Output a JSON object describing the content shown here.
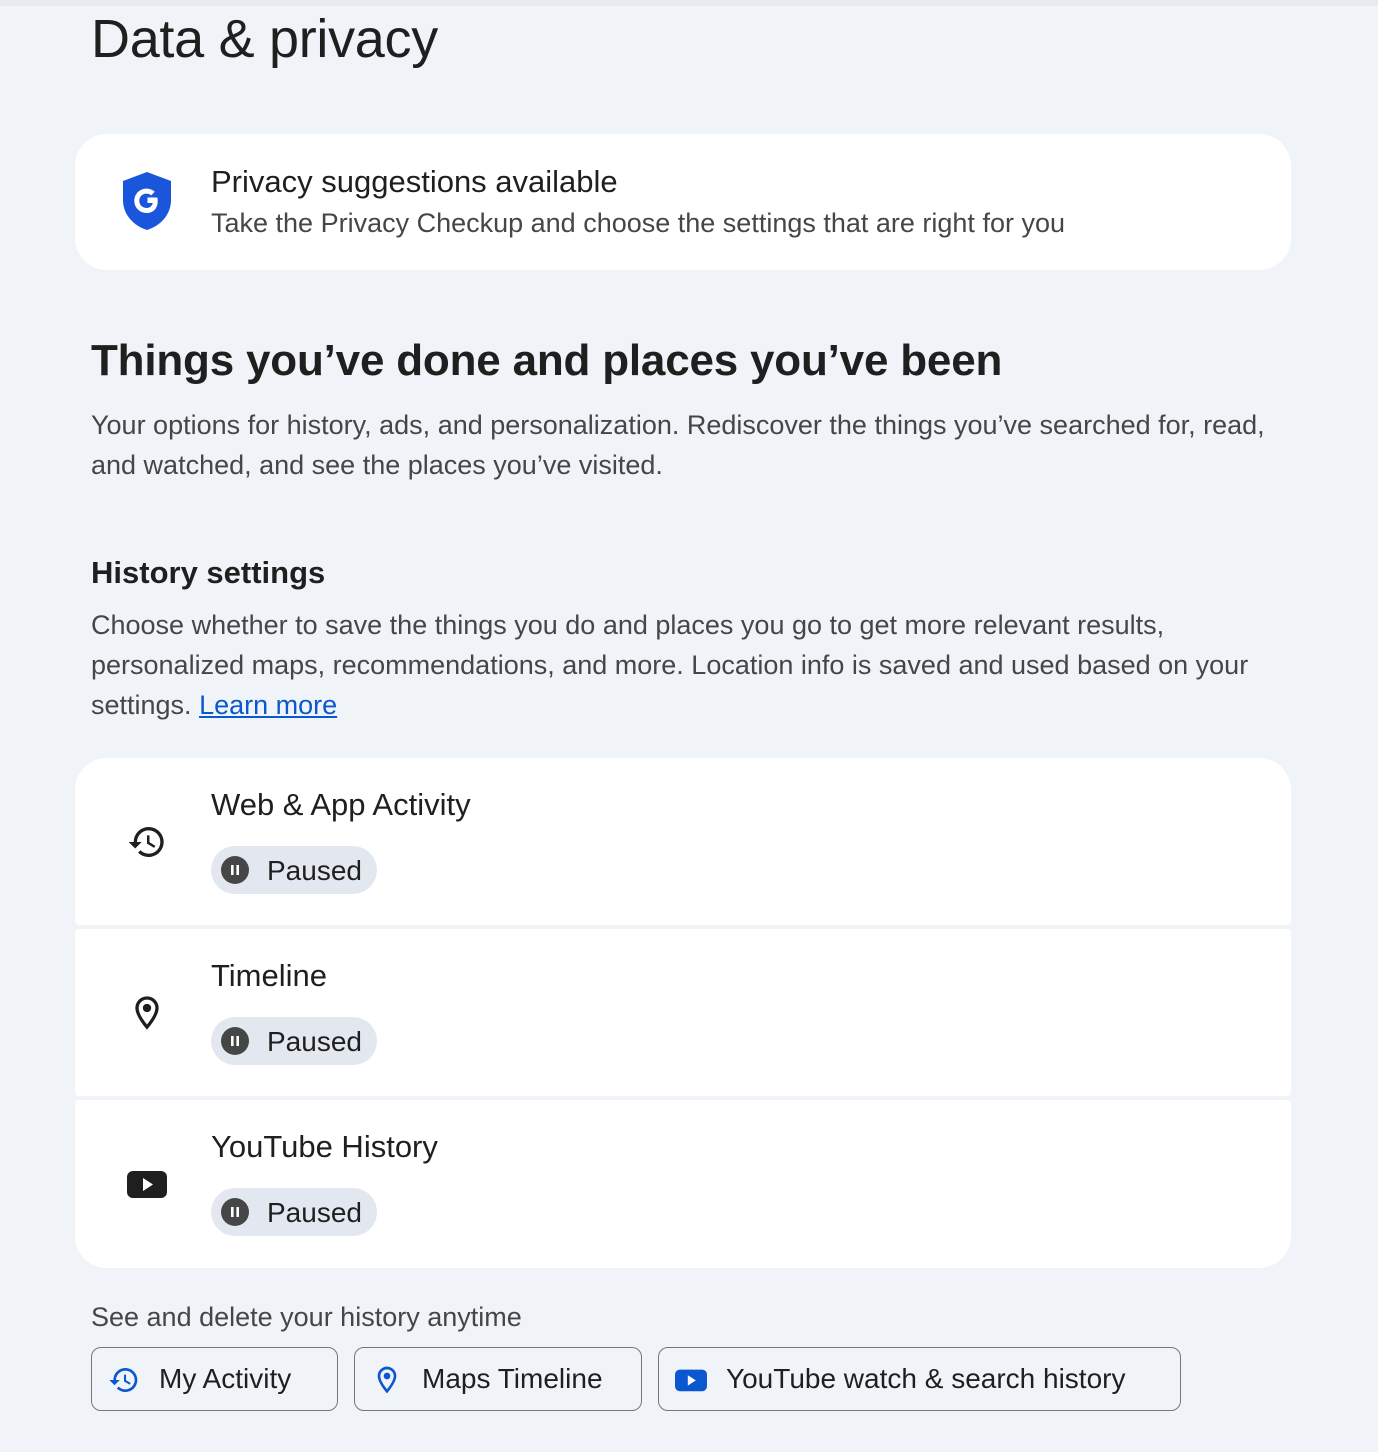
{
  "page": {
    "title": "Data & privacy"
  },
  "suggestion": {
    "title": "Privacy suggestions available",
    "description": "Take the Privacy Checkup and choose the settings that are right for you",
    "icon": "google-shield-icon"
  },
  "section": {
    "title": "Things you’ve done and places you’ve been",
    "description": "Your options for history, ads, and personalization. Rediscover the things you’ve searched for, read, and watched, and see the places you’ve visited."
  },
  "history_settings": {
    "title": "History settings",
    "description": "Choose whether to save the things you do and places you go to get more relevant results, personalized maps, recommendations, and more. Location info is saved and used based on your settings. ",
    "learn_more": "Learn more",
    "items": [
      {
        "title": "Web & App Activity",
        "status": "Paused",
        "icon": "history-icon"
      },
      {
        "title": "Timeline",
        "status": "Paused",
        "icon": "location-pin-icon"
      },
      {
        "title": "YouTube History",
        "status": "Paused",
        "icon": "youtube-icon"
      }
    ]
  },
  "history_links": {
    "label": "See and delete your history anytime",
    "buttons": [
      {
        "label": "My Activity",
        "icon": "history-icon"
      },
      {
        "label": "Maps Timeline",
        "icon": "location-pin-icon"
      },
      {
        "label": "YouTube watch & search history",
        "icon": "youtube-icon"
      }
    ]
  },
  "colors": {
    "background": "#f0f4f9",
    "card": "#ffffff",
    "accent_blue": "#0b57d0",
    "shield_blue": "#1a56db",
    "chip": "#e3e8f0"
  }
}
